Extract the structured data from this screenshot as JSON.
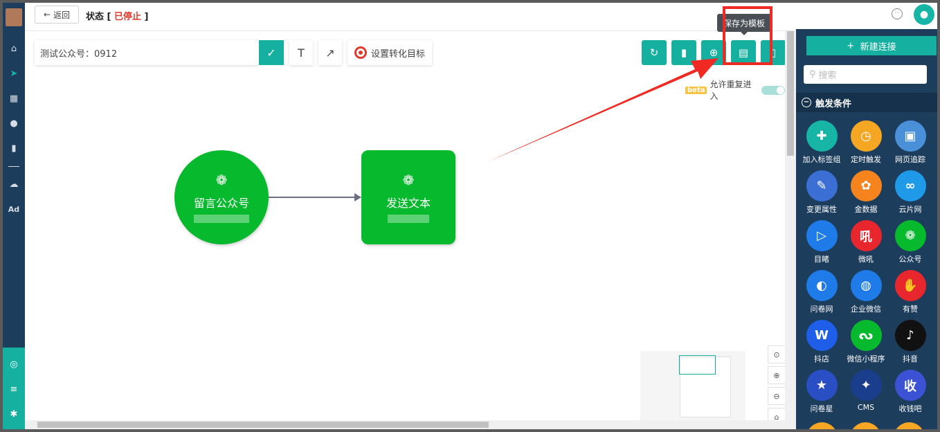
{
  "topbar": {
    "back_label": "返回",
    "status_label": "状态 [",
    "status_value": "已停止",
    "status_close": "]"
  },
  "toolbar": {
    "journey_name": "测试公众号：0912",
    "goal_label": "设置转化目标",
    "tooltip": "保存为模板",
    "beta_label": "beta",
    "allow_repeat_label": "允许重复进入"
  },
  "nodes": {
    "start_label": "留言公众号",
    "action_label": "发送文本"
  },
  "panel": {
    "new_connection": "新建连接",
    "search_placeholder": "搜索",
    "section_title": "触发条件",
    "items": [
      {
        "label": "加入标签组",
        "color": "#17b5a6",
        "icon": "user-add-icon"
      },
      {
        "label": "定时触发",
        "color": "#f5a623",
        "icon": "clock-icon"
      },
      {
        "label": "网页追踪",
        "color": "#4a90d9",
        "icon": "webpage-icon"
      },
      {
        "label": "变更属性",
        "color": "#3b6fd4",
        "icon": "edit-icon"
      },
      {
        "label": "金数据",
        "color": "#f5841f",
        "icon": "jinshuju-icon"
      },
      {
        "label": "云片网",
        "color": "#1e9ae8",
        "icon": "cloud-icon"
      },
      {
        "label": "目睹",
        "color": "#1e7be8",
        "icon": "play-icon"
      },
      {
        "label": "微吼",
        "color": "#e8262d",
        "icon": "weihou-icon"
      },
      {
        "label": "公众号",
        "color": "#07b92c",
        "icon": "wechat-icon"
      },
      {
        "label": "问卷网",
        "color": "#1e7be8",
        "icon": "wenjuan-icon"
      },
      {
        "label": "企业微信",
        "color": "#1e7be8",
        "icon": "wecom-icon"
      },
      {
        "label": "有赞",
        "color": "#e8262d",
        "icon": "thumb-icon"
      },
      {
        "label": "抖店",
        "color": "#1e5ee8",
        "icon": "doudian-icon"
      },
      {
        "label": "微信小程序",
        "color": "#07b92c",
        "icon": "miniprogram-icon"
      },
      {
        "label": "抖音",
        "color": "#111111",
        "icon": "douyin-icon"
      },
      {
        "label": "问卷星",
        "color": "#2a4fc4",
        "icon": "star-icon"
      },
      {
        "label": "CMS",
        "color": "#1a3d8c",
        "icon": "cms-icon"
      },
      {
        "label": "收钱吧",
        "color": "#3b52d4",
        "icon": "shouqianba-icon"
      }
    ]
  },
  "colors": {
    "brand": "#16b0a0",
    "node_green": "#07b92c",
    "stopped_red": "#e13a2c",
    "annotation_red": "#f02a22"
  }
}
